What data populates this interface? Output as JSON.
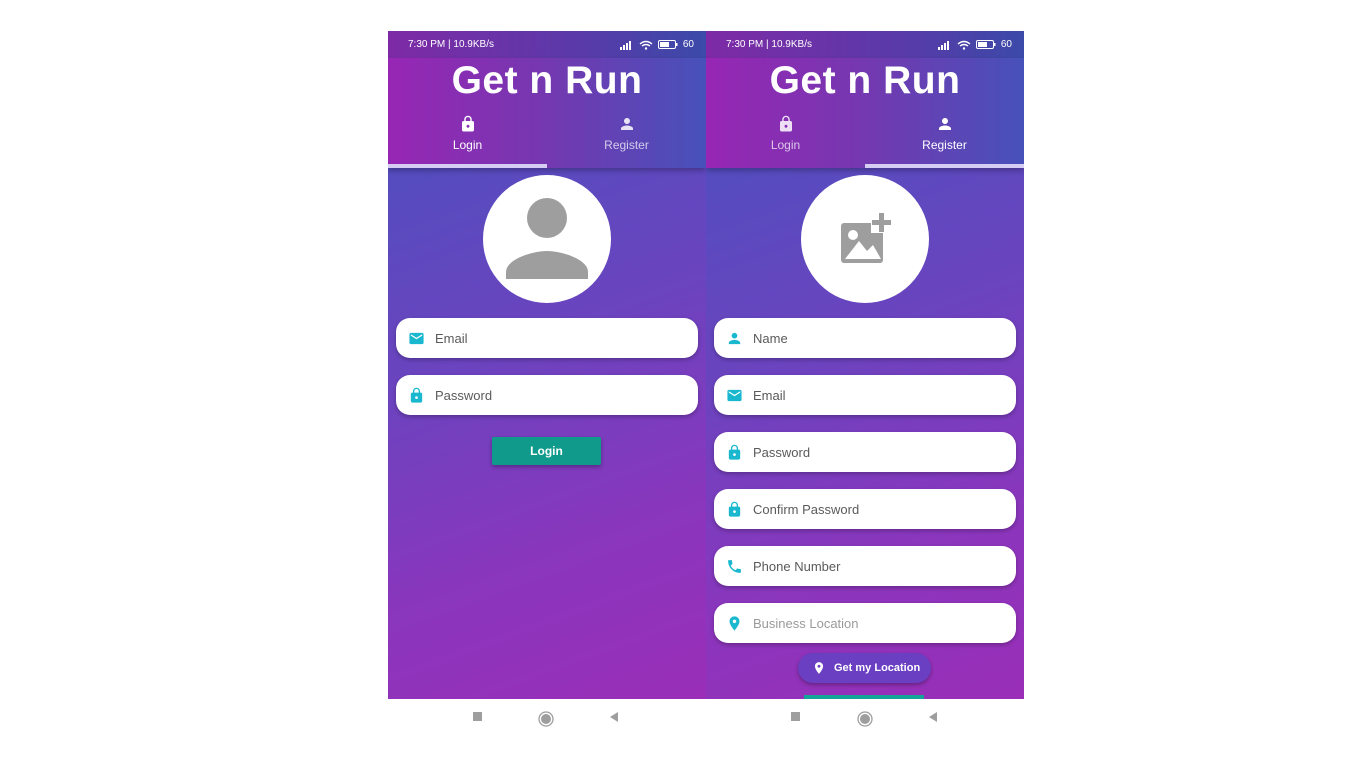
{
  "status_bar": {
    "time_info": "7:30 PM | 10.9KB/s",
    "battery": "60"
  },
  "app_title": "Get n Run",
  "tabs": [
    {
      "label": "Login",
      "icon": "lock-icon"
    },
    {
      "label": "Register",
      "icon": "person-icon"
    }
  ],
  "login_screen": {
    "active_tab": "Login",
    "avatar_icon": "person-icon",
    "fields": {
      "email_placeholder": "Email",
      "password_placeholder": "Password"
    },
    "login_button": "Login"
  },
  "register_screen": {
    "active_tab": "Register",
    "avatar_icon": "add-photo-icon",
    "fields": {
      "name_placeholder": "Name",
      "email_placeholder": "Email",
      "password_placeholder": "Password",
      "confirm_password_placeholder": "Confirm Password",
      "phone_placeholder": "Phone Number",
      "business_location_placeholder": "Business Location"
    },
    "location_button": "Get my Location"
  },
  "colors": {
    "accent_teal": "#109a8c",
    "icon_cyan": "#19b8cf",
    "location_button": "#6a3fc2",
    "gradient_start": "#4752bf",
    "gradient_end": "#9a2eb8"
  }
}
